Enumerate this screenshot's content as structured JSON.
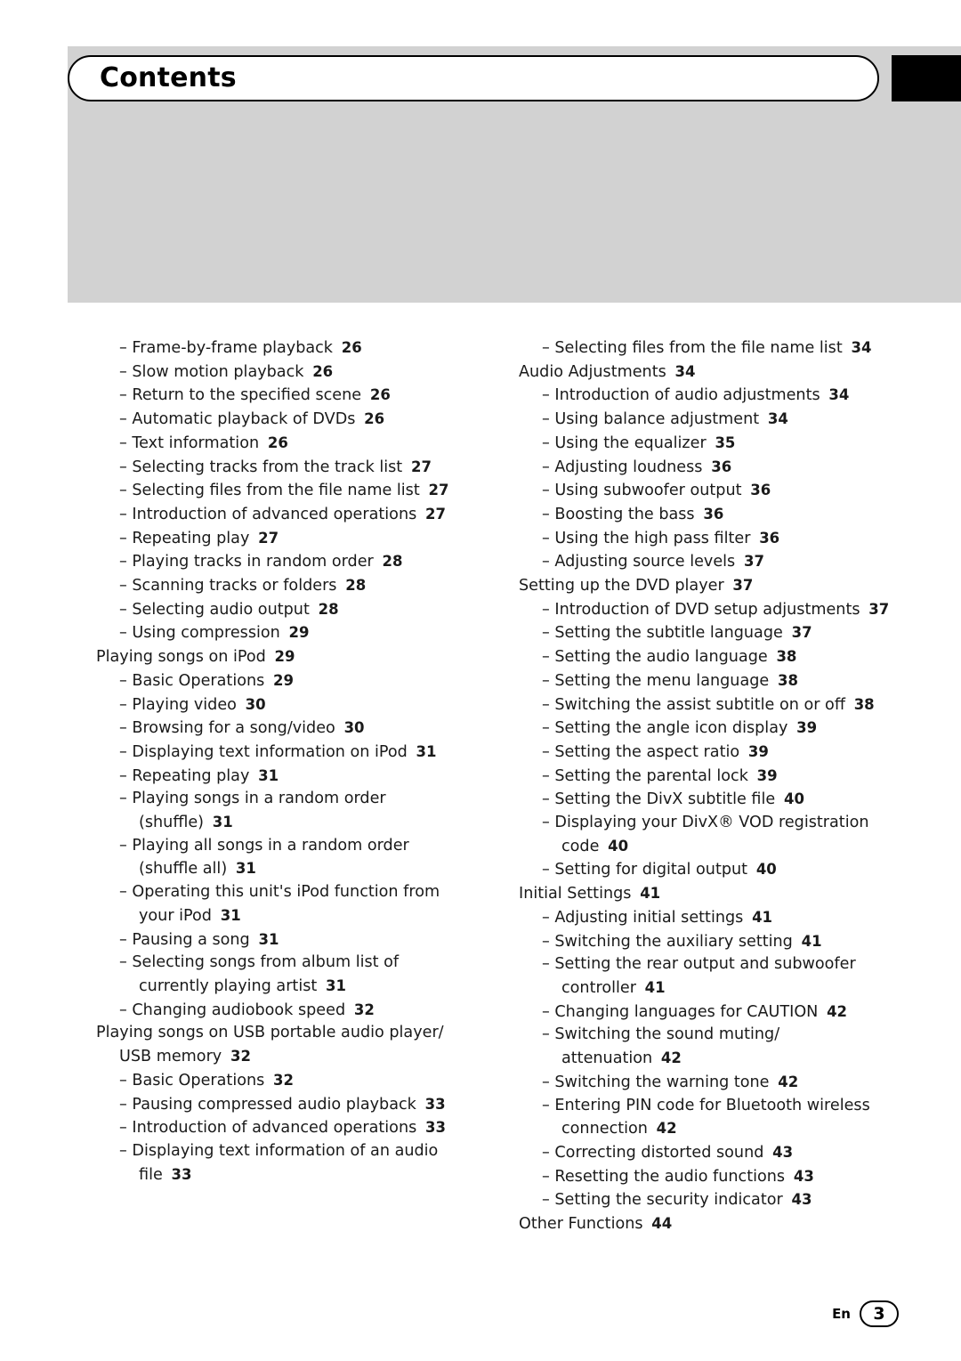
{
  "header": {
    "title": "Contents"
  },
  "footer": {
    "lang": "En",
    "page": "3"
  },
  "columns": {
    "left": [
      {
        "level": 1,
        "text": "Frame-by-frame playback",
        "page": "26"
      },
      {
        "level": 1,
        "text": "Slow motion playback",
        "page": "26"
      },
      {
        "level": 1,
        "text": "Return to the specified scene",
        "page": "26"
      },
      {
        "level": 1,
        "text": "Automatic playback of DVDs",
        "page": "26"
      },
      {
        "level": 1,
        "text": "Text information",
        "page": "26"
      },
      {
        "level": 1,
        "text": "Selecting tracks from the track list",
        "page": "27"
      },
      {
        "level": 1,
        "text": "Selecting files from the file name list",
        "page": "27"
      },
      {
        "level": 1,
        "text": "Introduction of advanced operations",
        "page": "27"
      },
      {
        "level": 1,
        "text": "Repeating play",
        "page": "27"
      },
      {
        "level": 1,
        "text": "Playing tracks in random order",
        "page": "28"
      },
      {
        "level": 1,
        "text": "Scanning tracks or folders",
        "page": "28"
      },
      {
        "level": 1,
        "text": "Selecting audio output",
        "page": "28"
      },
      {
        "level": 1,
        "text": "Using compression",
        "page": "29"
      },
      {
        "level": 0,
        "text": "Playing songs on iPod",
        "page": "29"
      },
      {
        "level": 1,
        "text": "Basic Operations",
        "page": "29"
      },
      {
        "level": 1,
        "text": "Playing video",
        "page": "30"
      },
      {
        "level": 1,
        "text": "Browsing for a song/video",
        "page": "30"
      },
      {
        "level": 1,
        "text": "Displaying text information on iPod",
        "page": "31"
      },
      {
        "level": 1,
        "text": "Repeating play",
        "page": "31"
      },
      {
        "level": 1,
        "text": "Playing songs in a random order (shuffle)",
        "page": "31"
      },
      {
        "level": 1,
        "text": "Playing all songs in a random order (shuffle all)",
        "page": "31"
      },
      {
        "level": 1,
        "text": "Operating this unit's iPod function from your iPod",
        "page": "31"
      },
      {
        "level": 1,
        "text": "Pausing a song",
        "page": "31"
      },
      {
        "level": 1,
        "text": "Selecting songs from album list of currently playing artist",
        "page": "31"
      },
      {
        "level": 1,
        "text": "Changing audiobook speed",
        "page": "32"
      },
      {
        "level": 0,
        "wrap": true,
        "text": "Playing songs on USB portable audio player/ USB memory",
        "page": "32"
      },
      {
        "level": 1,
        "text": "Basic Operations",
        "page": "32"
      },
      {
        "level": 1,
        "text": "Pausing compressed audio playback",
        "page": "33"
      },
      {
        "level": 1,
        "text": "Introduction of advanced operations",
        "page": "33"
      },
      {
        "level": 1,
        "text": "Displaying text information of an audio file",
        "page": "33"
      }
    ],
    "right": [
      {
        "level": 1,
        "text": "Selecting files from the file name list",
        "page": "34"
      },
      {
        "level": 0,
        "text": "Audio Adjustments",
        "page": "34"
      },
      {
        "level": 1,
        "text": "Introduction of audio adjustments",
        "page": "34"
      },
      {
        "level": 1,
        "text": "Using balance adjustment",
        "page": "34"
      },
      {
        "level": 1,
        "text": "Using the equalizer",
        "page": "35"
      },
      {
        "level": 1,
        "text": "Adjusting loudness",
        "page": "36"
      },
      {
        "level": 1,
        "text": "Using subwoofer output",
        "page": "36"
      },
      {
        "level": 1,
        "text": "Boosting the bass",
        "page": "36"
      },
      {
        "level": 1,
        "text": "Using the high pass filter",
        "page": "36"
      },
      {
        "level": 1,
        "text": "Adjusting source levels",
        "page": "37"
      },
      {
        "level": 0,
        "text": "Setting up the DVD player",
        "page": "37"
      },
      {
        "level": 1,
        "text": "Introduction of DVD setup adjustments",
        "page": "37"
      },
      {
        "level": 1,
        "text": "Setting the subtitle language",
        "page": "37"
      },
      {
        "level": 1,
        "text": "Setting the audio language",
        "page": "38"
      },
      {
        "level": 1,
        "text": "Setting the menu language",
        "page": "38"
      },
      {
        "level": 1,
        "text": "Switching the assist subtitle on or off",
        "page": "38"
      },
      {
        "level": 1,
        "text": "Setting the angle icon display",
        "page": "39"
      },
      {
        "level": 1,
        "text": "Setting the aspect ratio",
        "page": "39"
      },
      {
        "level": 1,
        "text": "Setting the parental lock",
        "page": "39"
      },
      {
        "level": 1,
        "text": "Setting the DivX subtitle file",
        "page": "40"
      },
      {
        "level": 1,
        "text": "Displaying your DivX® VOD registration code",
        "page": "40"
      },
      {
        "level": 1,
        "text": "Setting for digital output",
        "page": "40"
      },
      {
        "level": 0,
        "text": "Initial Settings",
        "page": "41"
      },
      {
        "level": 1,
        "text": "Adjusting initial settings",
        "page": "41"
      },
      {
        "level": 1,
        "text": "Switching the auxiliary setting",
        "page": "41"
      },
      {
        "level": 1,
        "text": "Setting the rear output and subwoofer controller",
        "page": "41"
      },
      {
        "level": 1,
        "text": "Changing languages for CAUTION",
        "page": "42"
      },
      {
        "level": 1,
        "text": "Switching the sound muting/ attenuation",
        "page": "42"
      },
      {
        "level": 1,
        "text": "Switching the warning tone",
        "page": "42"
      },
      {
        "level": 1,
        "text": "Entering PIN code for Bluetooth wireless connection",
        "page": "42"
      },
      {
        "level": 1,
        "text": "Correcting distorted sound",
        "page": "43"
      },
      {
        "level": 1,
        "text": "Resetting the audio functions",
        "page": "43"
      },
      {
        "level": 1,
        "text": "Setting the security indicator",
        "page": "43"
      },
      {
        "level": 0,
        "text": "Other Functions",
        "page": "44"
      }
    ]
  }
}
